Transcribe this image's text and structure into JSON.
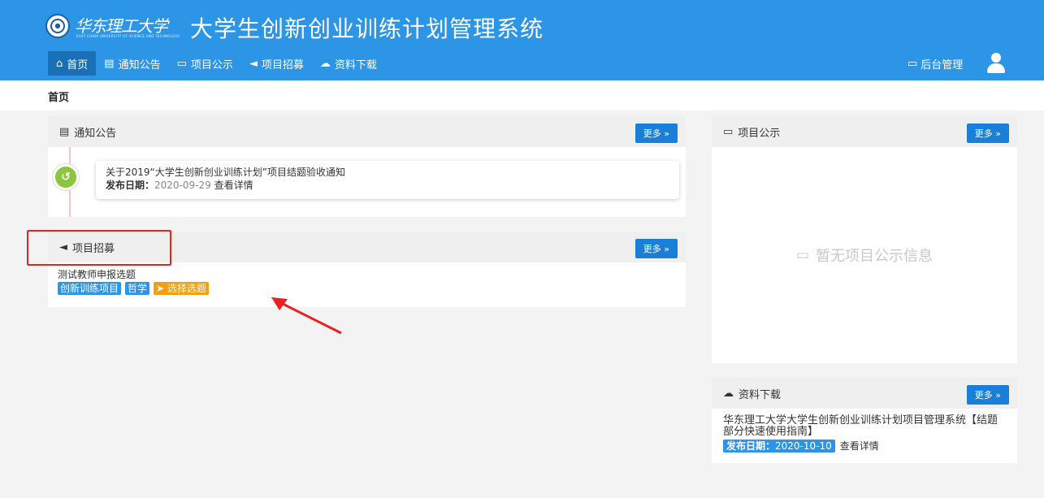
{
  "header": {
    "school_name": "华东理工大学",
    "school_subtitle": "EAST CHINA UNIVERSITY OF SCIENCE AND TECHNOLOGY",
    "system_title": "大学生创新创业训练计划管理系统",
    "nav": [
      {
        "label": "首页",
        "icon": "home-icon",
        "active": true
      },
      {
        "label": "通知公告",
        "icon": "document-icon"
      },
      {
        "label": "项目公示",
        "icon": "comment-icon"
      },
      {
        "label": "项目招募",
        "icon": "megaphone-icon"
      },
      {
        "label": "资料下载",
        "icon": "cloud-download-icon"
      }
    ],
    "admin_label": "后台管理"
  },
  "breadcrumb": {
    "current": "首页"
  },
  "notice": {
    "title": "通知公告",
    "more": "更多 »",
    "item": {
      "title": "关于2019“大学生创新创业训练计划”项目结题验收通知",
      "date_label": "发布日期：",
      "date": "2020-09-29",
      "detail": "查看详情"
    }
  },
  "recruit": {
    "title": "项目招募",
    "more": "更多 »",
    "item": {
      "title": "测试教师申报选题",
      "tags": [
        "创新训练项目",
        "哲学"
      ],
      "action": "选择选题"
    }
  },
  "publicity": {
    "title": "项目公示",
    "more": "更多 »",
    "empty_text": "暂无项目公示信息"
  },
  "download": {
    "title": "资料下载",
    "more": "更多 »",
    "item": {
      "title": "华东理工大学大学生创新创业训练计划项目管理系统【结题部分快速使用指南】",
      "date_label": "发布日期：",
      "date": "2020-10-10",
      "detail": "查看详情"
    }
  },
  "colors": {
    "header_bg": "#2d95e6",
    "nav_active": "#1a6fb5",
    "more_btn": "#1a7fd6",
    "tag_blue": "#2d95e6",
    "tag_orange": "#f0a010",
    "annotation_red": "#e8231f"
  }
}
